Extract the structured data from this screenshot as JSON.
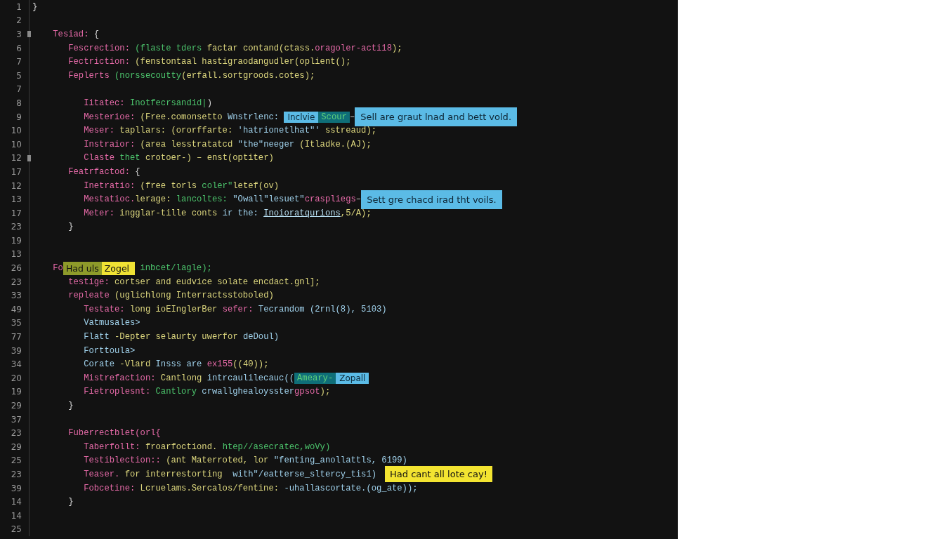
{
  "editor": {
    "lines": [
      {
        "number": "1",
        "marker": false,
        "tokens": [
          {
            "kind": "plain",
            "text": "}"
          }
        ]
      },
      {
        "number": "2",
        "marker": false
      },
      {
        "number": "3",
        "marker": true,
        "tokens": [
          {
            "kind": "key",
            "text": "    Tesiad:"
          },
          {
            "kind": "plain",
            "text": " {"
          }
        ]
      },
      {
        "number": "6",
        "marker": false,
        "tokens": [
          {
            "kind": "key",
            "text": "       Fescrection:"
          },
          {
            "kind": "green",
            "text": " (flaste tders"
          },
          {
            "kind": "str",
            "text": " factar contand(ctass."
          },
          {
            "kind": "key",
            "text": "oragoler-acti18"
          },
          {
            "kind": "str",
            "text": ");"
          }
        ]
      },
      {
        "number": "7",
        "marker": false,
        "tokens": [
          {
            "kind": "key",
            "text": "       Fectriction:"
          },
          {
            "kind": "str",
            "text": " (fenstontaal hastigraodangudler(oplient();"
          }
        ]
      },
      {
        "number": "5",
        "marker": false,
        "tokens": [
          {
            "kind": "key",
            "text": "       Feplerts"
          },
          {
            "kind": "green",
            "text": " (norssecoutty"
          },
          {
            "kind": "str",
            "text": "(erfall.sortgroods.cotes);"
          }
        ]
      },
      {
        "number": "7",
        "marker": false
      },
      {
        "number": "8",
        "marker": false,
        "tokens": [
          {
            "kind": "key",
            "text": "          Iitatec:"
          },
          {
            "kind": "green",
            "text": " Inotfecrsandid|"
          },
          {
            "kind": "plain",
            "text": ")"
          }
        ]
      },
      {
        "number": "9",
        "marker": false,
        "tokens": [
          {
            "kind": "key",
            "text": "          Mesterioe:"
          },
          {
            "kind": "str",
            "text": " (Free.comonsetto"
          },
          {
            "kind": "blue",
            "text": " Wnstrlenc: "
          },
          {
            "kind": "tag-blue",
            "text": "Inclvie"
          },
          {
            "kind": "tag-teal",
            "text": "Scour"
          },
          {
            "kind": "plain",
            "text": "–"
          },
          {
            "kind": "callout-blue",
            "text": "Sell are graut lnad and bett vold."
          }
        ]
      },
      {
        "number": "10",
        "marker": false,
        "tokens": [
          {
            "kind": "key",
            "text": "          Meser:"
          },
          {
            "kind": "str",
            "text": " tapllars: (ororffarte:"
          },
          {
            "kind": "blue",
            "text": " 'hatrionetlhat\"' "
          },
          {
            "kind": "str",
            "text": "sstreaud);"
          }
        ]
      },
      {
        "number": "10",
        "marker": false,
        "tokens": [
          {
            "kind": "key",
            "text": "          Instraior:"
          },
          {
            "kind": "str",
            "text": " (area lesstratatcd"
          },
          {
            "kind": "blue",
            "text": " \"the\"neeger"
          },
          {
            "kind": "str",
            "text": " (Itladke.(AJ);"
          }
        ]
      },
      {
        "number": "12",
        "marker": true,
        "tokens": [
          {
            "kind": "key",
            "text": "          Claste"
          },
          {
            "kind": "green",
            "text": " thet"
          },
          {
            "kind": "str",
            "text": " crotoer-) – enst(optiter)"
          }
        ]
      },
      {
        "number": "17",
        "marker": false,
        "tokens": [
          {
            "kind": "key",
            "text": "       Featrfactod:"
          },
          {
            "kind": "plain",
            "text": " {"
          }
        ]
      },
      {
        "number": "12",
        "marker": false,
        "tokens": [
          {
            "kind": "key",
            "text": "          Inetratio:"
          },
          {
            "kind": "str",
            "text": " (free torls"
          },
          {
            "kind": "green",
            "text": " coler\""
          },
          {
            "kind": "str",
            "text": "letef(ov)"
          }
        ]
      },
      {
        "number": "13",
        "marker": false,
        "tokens": [
          {
            "kind": "key",
            "text": "          Mestatioc."
          },
          {
            "kind": "str",
            "text": "lerage:"
          },
          {
            "kind": "green",
            "text": " lancoltes:"
          },
          {
            "kind": "blue",
            "text": " \"Owall\"lesuet\""
          },
          {
            "kind": "key",
            "text": "craspliegs"
          },
          {
            "kind": "plain",
            "text": "–"
          },
          {
            "kind": "callout-blue",
            "text": "Sett gre chacd irad tht voils."
          }
        ]
      },
      {
        "number": "17",
        "marker": false,
        "tokens": [
          {
            "kind": "key",
            "text": "          Meter:"
          },
          {
            "kind": "str",
            "text": " ingglar-tille conts"
          },
          {
            "kind": "blue",
            "text": " ir the: "
          },
          {
            "kind": "link",
            "text": "Inoioratqurions"
          },
          {
            "kind": "str",
            "text": ",5/A);"
          }
        ]
      },
      {
        "number": "23",
        "marker": false,
        "tokens": [
          {
            "kind": "plain",
            "text": "       }"
          }
        ]
      },
      {
        "number": "19",
        "marker": false
      },
      {
        "number": "13",
        "marker": false
      },
      {
        "number": "26",
        "marker": false,
        "tokens": [
          {
            "kind": "key",
            "text": "    Fo"
          },
          {
            "kind": "tag-olive",
            "text": "Had uls"
          },
          {
            "kind": "tag-yellow",
            "text": "Zogel"
          },
          {
            "kind": "green",
            "text": " inbcet/lagle);"
          }
        ]
      },
      {
        "number": "23",
        "marker": false,
        "tokens": [
          {
            "kind": "key",
            "text": "       testige:"
          },
          {
            "kind": "str",
            "text": " cortser and eudvice solate encdact.gnl];"
          }
        ]
      },
      {
        "number": "33",
        "marker": false,
        "tokens": [
          {
            "kind": "key",
            "text": "       repleate"
          },
          {
            "kind": "str",
            "text": " (uglichlong Interractsstoboled)"
          }
        ]
      },
      {
        "number": "49",
        "marker": false,
        "tokens": [
          {
            "kind": "key",
            "text": "          Testate:"
          },
          {
            "kind": "str",
            "text": " long ioEInglerBer"
          },
          {
            "kind": "key",
            "text": " sefer:"
          },
          {
            "kind": "blue",
            "text": " Tecrandom (2rnl(8), 5103)"
          }
        ]
      },
      {
        "number": "35",
        "marker": false,
        "tokens": [
          {
            "kind": "blue",
            "text": "          Vatmusales>"
          }
        ]
      },
      {
        "number": "77",
        "marker": false,
        "tokens": [
          {
            "kind": "blue",
            "text": "          Flatt"
          },
          {
            "kind": "str",
            "text": " -Depter selaurty uwerfor"
          },
          {
            "kind": "blue",
            "text": " deDoul)"
          }
        ]
      },
      {
        "number": "39",
        "marker": false,
        "tokens": [
          {
            "kind": "blue",
            "text": "          Forttoula>"
          }
        ]
      },
      {
        "number": "34",
        "marker": false,
        "tokens": [
          {
            "kind": "blue",
            "text": "          Corate"
          },
          {
            "kind": "str",
            "text": " -Vlard"
          },
          {
            "kind": "blue",
            "text": " Insss are"
          },
          {
            "kind": "key",
            "text": " ex155"
          },
          {
            "kind": "str",
            "text": "((40));"
          }
        ]
      },
      {
        "number": "20",
        "marker": false,
        "tokens": [
          {
            "kind": "key",
            "text": "          Mistrefaction:"
          },
          {
            "kind": "str",
            "text": " Cantlong"
          },
          {
            "kind": "blue",
            "text": " intrcaulilecauc(("
          },
          {
            "kind": "tag-teal",
            "text": "Ameary-"
          },
          {
            "kind": "tag-blue",
            "text": "Zopall"
          }
        ]
      },
      {
        "number": "19",
        "marker": false,
        "tokens": [
          {
            "kind": "key",
            "text": "          Fietroplesnt:"
          },
          {
            "kind": "green",
            "text": " Cantlory"
          },
          {
            "kind": "blue",
            "text": " crwallghealoysster"
          },
          {
            "kind": "key",
            "text": "gpsot"
          },
          {
            "kind": "str",
            "text": ");"
          }
        ]
      },
      {
        "number": "29",
        "marker": false,
        "tokens": [
          {
            "kind": "plain",
            "text": "       }"
          }
        ]
      },
      {
        "number": "37",
        "marker": false
      },
      {
        "number": "23",
        "marker": false,
        "tokens": [
          {
            "kind": "key",
            "text": "       Fuberrectblet(orl{"
          }
        ]
      },
      {
        "number": "29",
        "marker": false,
        "tokens": [
          {
            "kind": "key",
            "text": "          Taberfollt:"
          },
          {
            "kind": "str",
            "text": " froarfoctiond."
          },
          {
            "kind": "green",
            "text": " htep//asecratec,woVy)"
          }
        ]
      },
      {
        "number": "25",
        "marker": false,
        "tokens": [
          {
            "kind": "key",
            "text": "          Testiblection::"
          },
          {
            "kind": "str",
            "text": " (ant Materroted, lor"
          },
          {
            "kind": "blue",
            "text": " \"fenting_anollattls, 6199)"
          }
        ]
      },
      {
        "number": "23",
        "marker": false,
        "tokens": [
          {
            "kind": "key",
            "text": "          Teaser."
          },
          {
            "kind": "str",
            "text": " for interrestorting"
          },
          {
            "kind": "blue",
            "text": "  with\"/eatterse_sltercy_tis1)"
          },
          {
            "kind": "callout-yellow",
            "text": "Had cant all lote cay!"
          }
        ]
      },
      {
        "number": "39",
        "marker": false,
        "tokens": [
          {
            "kind": "key",
            "text": "          Fobcetine:"
          },
          {
            "kind": "str",
            "text": " Lcruelams.Sercalos/fentine:"
          },
          {
            "kind": "blue",
            "text": " -uhallascortate.(og_ate));"
          }
        ]
      },
      {
        "number": "14",
        "marker": false,
        "tokens": [
          {
            "kind": "plain",
            "text": "       }"
          }
        ]
      },
      {
        "number": "14",
        "marker": false
      },
      {
        "number": "25",
        "marker": false
      }
    ]
  }
}
